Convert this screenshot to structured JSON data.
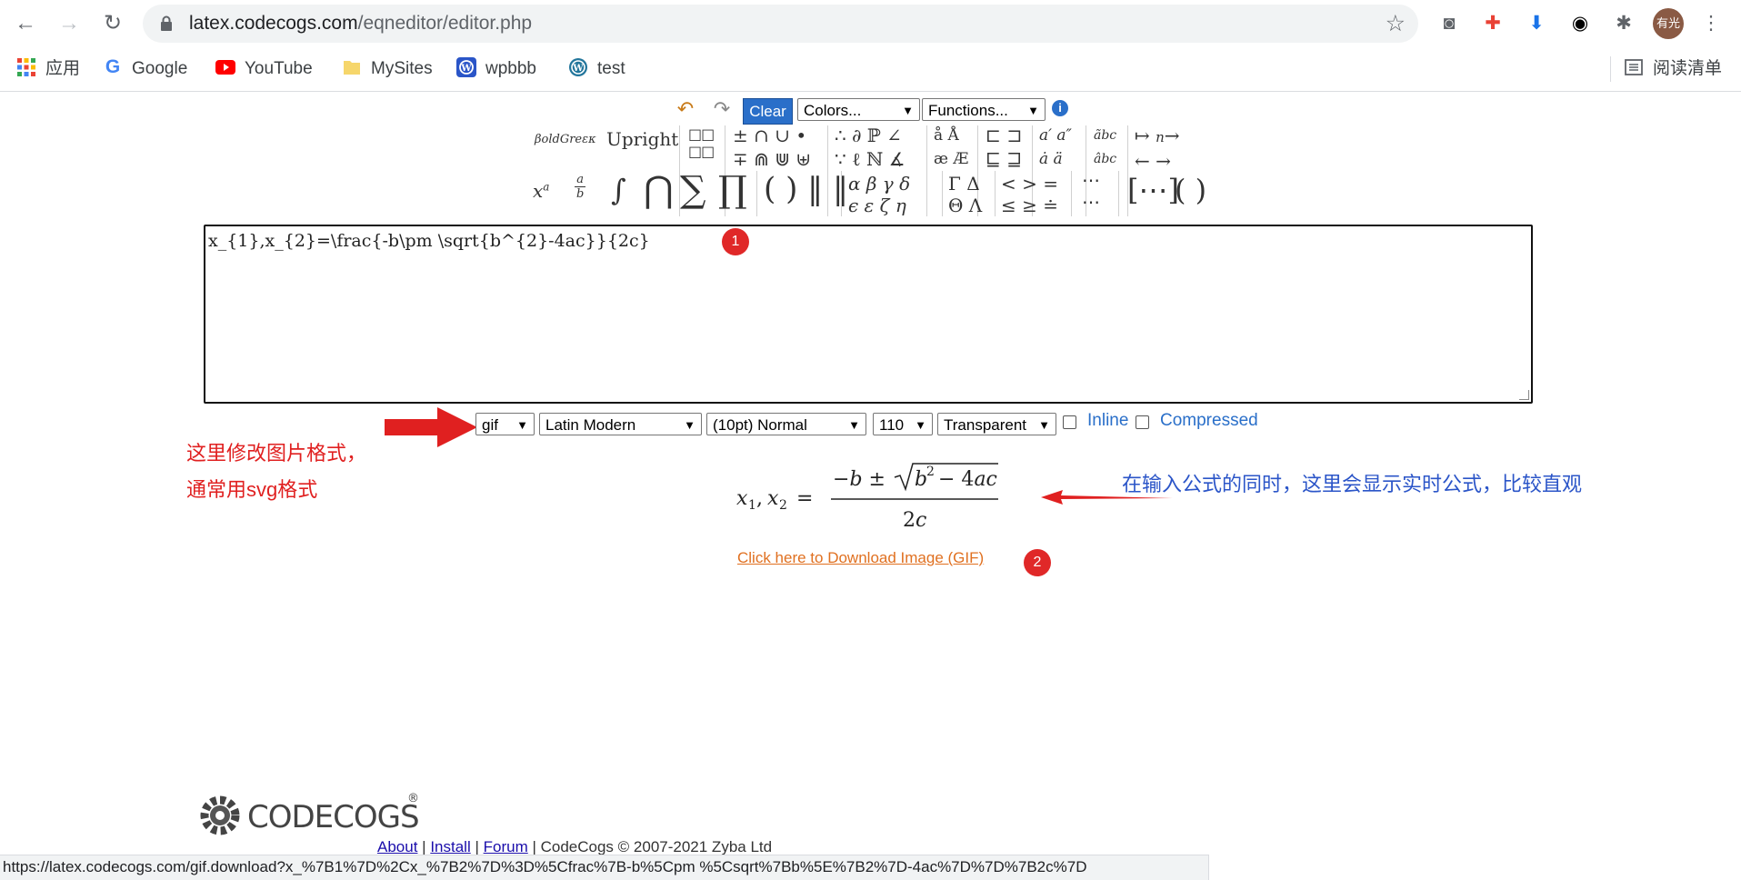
{
  "browser": {
    "url_domain": "latex.codecogs.com",
    "url_path": "/eqneditor/editor.php",
    "profile_label": "有光",
    "bookmarks": [
      {
        "label": "应用",
        "icon": "apps-grid-icon"
      },
      {
        "label": "Google",
        "icon": "google-icon"
      },
      {
        "label": "YouTube",
        "icon": "youtube-icon"
      },
      {
        "label": "MySites",
        "icon": "folder-icon"
      },
      {
        "label": "wpbbb",
        "icon": "wordpress-icon"
      },
      {
        "label": "test",
        "icon": "wordpress-icon"
      }
    ],
    "reading_list": "阅读清单",
    "status_url": "https://latex.codecogs.com/gif.download?x_%7B1%7D%2Cx_%7B2%7D%3D%5Cfrac%7B-b%5Cpm %5Csqrt%7Bb%5E%7B2%7D-4ac%7D%7D%7B2c%7D"
  },
  "editor": {
    "toolbar": {
      "clear_label": "Clear",
      "colors_label": "Colors...",
      "functions_label": "Functions..."
    },
    "symbols": {
      "boldgreek": "βoldGreεκ",
      "upright": "Upright"
    },
    "latex_input": "x_{1},x_{2}=\\frac{-b\\pm \\sqrt{b^{2}-4ac}}{2c}",
    "options": {
      "format": "gif",
      "font": "Latin Modern",
      "size": "(10pt) Normal",
      "dpi": "110",
      "background": "Transparent",
      "inline_label": "Inline",
      "compressed_label": "Compressed"
    },
    "download_label": "Click here to Download Image (GIF)"
  },
  "annotations": {
    "badge1": "1",
    "badge2": "2",
    "format_note_line1": "这里修改图片格式，",
    "format_note_line2": "通常用svg格式",
    "preview_note": "在输入公式的同时，这里会显示实时公式，比较直观"
  },
  "footer": {
    "brand": "CODECOGS",
    "about": "About",
    "install": "Install",
    "forum": "Forum",
    "copyright": "CodeCogs © 2007-2021 Zyba Ltd"
  },
  "colors": {
    "accent_blue": "#2a6fc9",
    "annotation_red": "#e02020",
    "annotation_blue": "#2b55c8",
    "download_orange": "#e07020"
  }
}
